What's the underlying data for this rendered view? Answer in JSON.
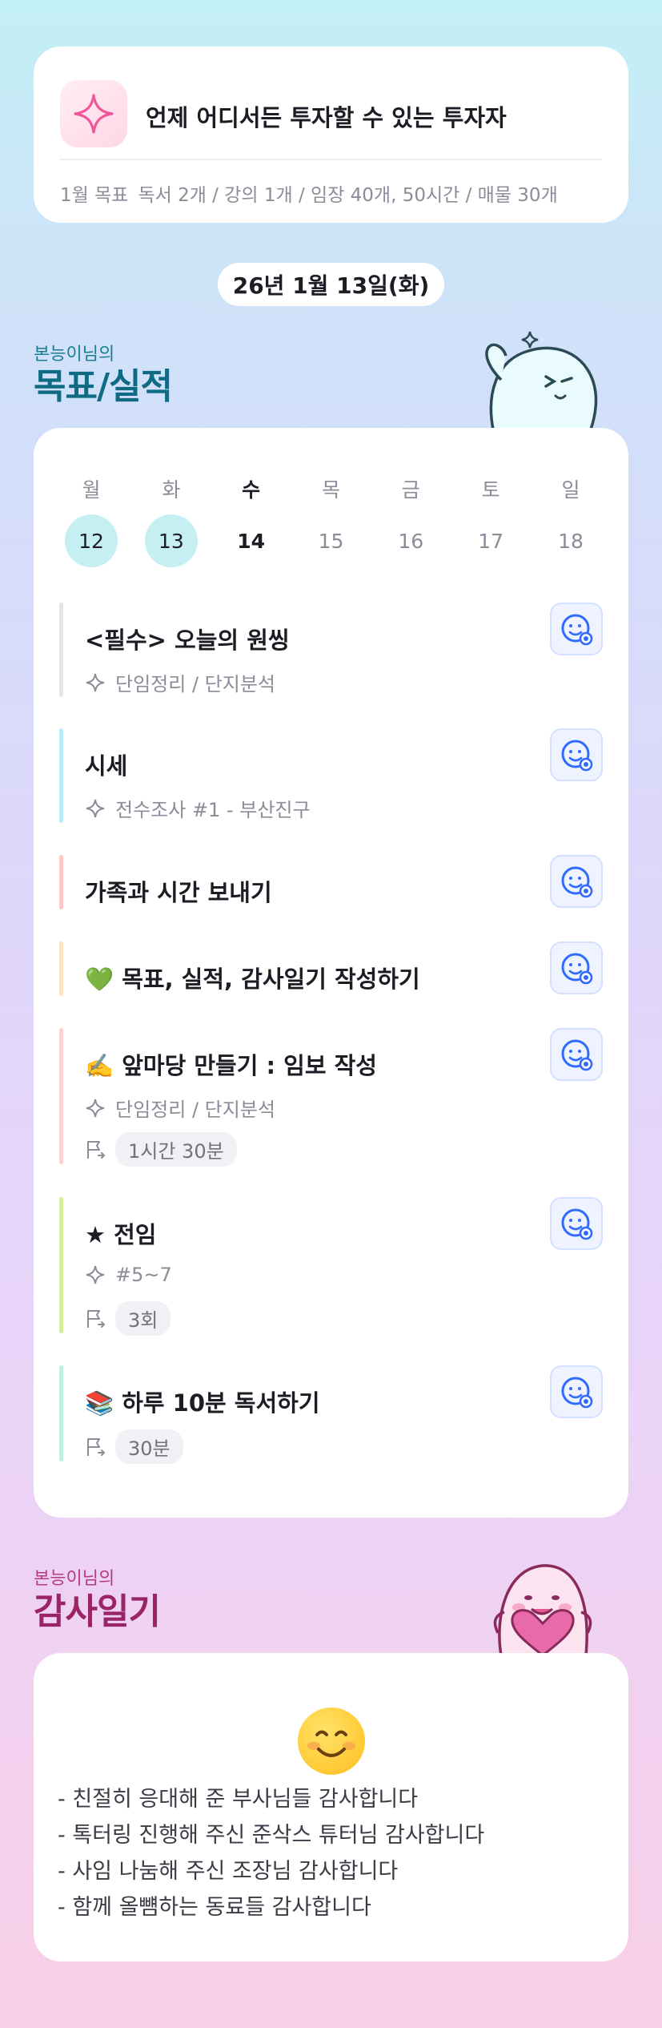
{
  "goal": {
    "icon": "sparkle-icon",
    "title": "언제 어디서든 투자할 수 있는 투자자",
    "subtitle_label": "1월 목표",
    "subtitle_text": "독서 2개 / 강의 1개 / 임장 40개, 50시간 / 매물 30개"
  },
  "date": "26년 1월 13일(화)",
  "goals_section": {
    "small": "본능이님의",
    "big": "목표/실적"
  },
  "week": {
    "weekdays": [
      "월",
      "화",
      "수",
      "목",
      "금",
      "토",
      "일"
    ],
    "days": [
      "12",
      "13",
      "14",
      "15",
      "16",
      "17",
      "18"
    ]
  },
  "tasks": [
    {
      "title": "<필수> 오늘의 원씽",
      "category": "단임정리 / 단지분석",
      "bar_color": "#e4e4ea"
    },
    {
      "title": "시세",
      "category": "전수조사 #1 - 부산진구",
      "bar_color": "#b9ecf2"
    },
    {
      "title": "가족과 시간 보내기",
      "bar_color": "#fcc9c6"
    },
    {
      "title": "💚 목표, 실적, 감사일기 작성하기",
      "bar_color": "#fde3bf"
    },
    {
      "title": "✍️ 앞마당 만들기 : 임보 작성",
      "category": "단임정리 / 단지분석",
      "progress": "1시간 30분",
      "bar_color": "#fdd2d0"
    },
    {
      "title": "★ 전임",
      "category": "#5~7",
      "progress": "3회",
      "bar_color": "#d6ee9c"
    },
    {
      "title": "📚 하루 10분 독서하기",
      "progress": "30분",
      "bar_color": "#bfeee3"
    }
  ],
  "thanks_section": {
    "small": "본능이님의",
    "big": "감사일기"
  },
  "thanks": {
    "emoji": "smiling-face-icon",
    "lines": [
      "- 친절히 응대해 준 부사님들 감사합니다",
      "- 톡터링 진행해 주신 준삭스 튜터님 감사합니다",
      "- 사임 나눔해 주신 조장님 감사합니다",
      "- 함께 올뻄하는 동료들 감사합니다"
    ]
  },
  "colors": {
    "accent_teal": "#0f6b84",
    "accent_pink": "#9a2566",
    "check_blue": "#2f6bff"
  }
}
